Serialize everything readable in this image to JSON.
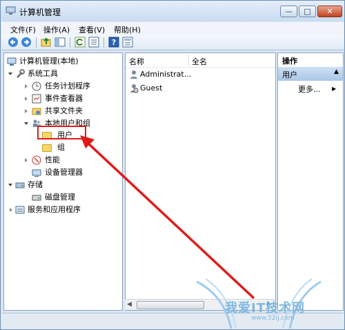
{
  "window": {
    "title": "计算机管理"
  },
  "menubar": [
    {
      "label": "文件(F)"
    },
    {
      "label": "操作(A)"
    },
    {
      "label": "查看(V)"
    },
    {
      "label": "帮助(H)"
    }
  ],
  "toolbar": {
    "icons": [
      "back-icon",
      "forward-icon",
      "up-folder-icon",
      "show-hide-tree-icon",
      "refresh-icon",
      "export-list-icon",
      "help-icon",
      "properties-icon"
    ]
  },
  "tree": {
    "root": "计算机管理(本地)",
    "system_tools": "系统工具",
    "task_scheduler": "任务计划程序",
    "event_viewer": "事件查看器",
    "shared_folders": "共享文件夹",
    "local_users_groups": "本地用户和组",
    "users": "用户",
    "groups": "组",
    "performance": "性能",
    "device_manager": "设备管理器",
    "storage": "存储",
    "disk_management": "磁盘管理",
    "services_apps": "服务和应用程序"
  },
  "list": {
    "columns": [
      "名称",
      "全名"
    ],
    "rows": [
      {
        "name": "Administrat...",
        "fullname": ""
      },
      {
        "name": "Guest",
        "fullname": ""
      }
    ]
  },
  "actions": {
    "header": "操作",
    "selected": "用户",
    "more": "更多..."
  },
  "watermark": {
    "text": "我爱IT技术网",
    "url": "www.52ij.com"
  },
  "colors": {
    "highlight_box": "#e01a1a",
    "arrow": "#e01a1a"
  }
}
